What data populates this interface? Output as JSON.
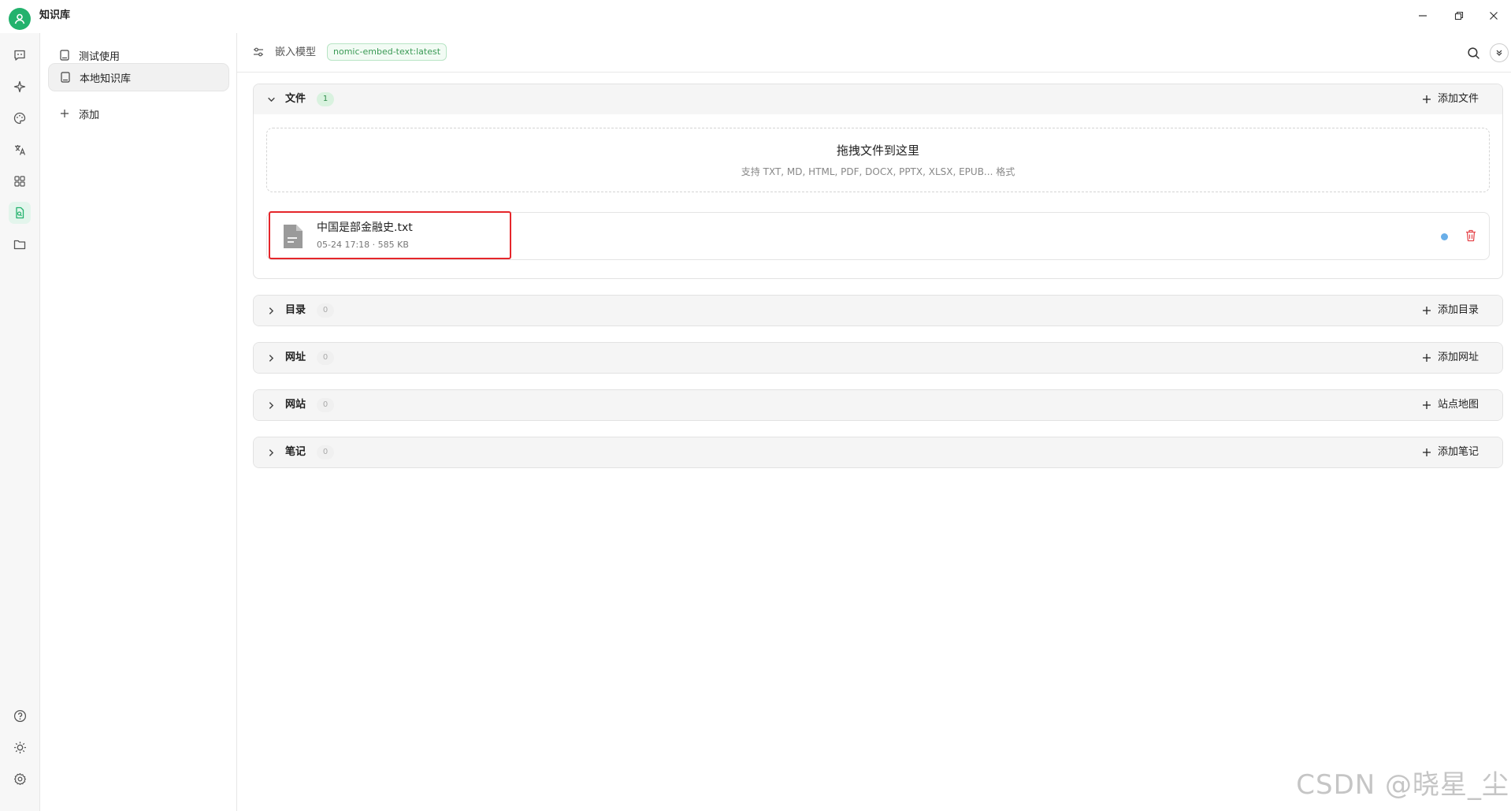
{
  "app": {
    "title": "知识库",
    "avatar_icon": "user-icon",
    "accent_color": "#23b26d"
  },
  "window_controls": [
    "minimize-icon",
    "restore-icon",
    "close-icon"
  ],
  "rail": {
    "top": [
      "chat-icon",
      "sparkle-icon",
      "palette-icon",
      "translate-icon",
      "apps-icon",
      "knowledge-icon",
      "folder-icon"
    ],
    "active": "knowledge-icon",
    "bottom": [
      "help-icon",
      "brightness-icon",
      "settings-icon"
    ]
  },
  "knowledge_list": {
    "items": [
      {
        "label": "测试使用",
        "icon": "book-icon"
      },
      {
        "label": "本地知识库",
        "icon": "book-icon",
        "selected": true
      }
    ],
    "add_label": "添加"
  },
  "toolbar": {
    "embed_label": "嵌入模型",
    "embed_model": "nomic-embed-text:latest"
  },
  "sections": {
    "files": {
      "title": "文件",
      "count": "1",
      "action": "添加文件",
      "expanded": true
    },
    "directories": {
      "title": "目录",
      "count": "0",
      "action": "添加目录"
    },
    "urls": {
      "title": "网址",
      "count": "0",
      "action": "添加网址"
    },
    "sites": {
      "title": "网站",
      "count": "0",
      "action": "站点地图"
    },
    "notes": {
      "title": "笔记",
      "count": "0",
      "action": "添加笔记"
    }
  },
  "dropzone": {
    "title": "拖拽文件到这里",
    "subtitle": "支持 TXT, MD, HTML, PDF, DOCX, PPTX, XLSX, EPUB... 格式"
  },
  "files": [
    {
      "name": "中国是部金融史.txt",
      "meta": "05-24 17:18 · 585 KB",
      "status_color": "#69aee8"
    }
  ],
  "watermark": "CSDN @晓星_尘"
}
